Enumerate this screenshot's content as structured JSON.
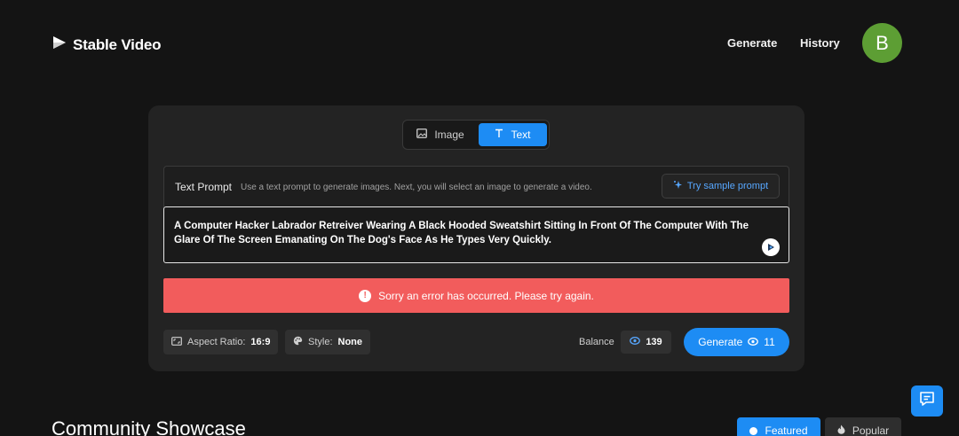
{
  "app": {
    "name": "Stable Video"
  },
  "nav": {
    "generate": "Generate",
    "history": "History",
    "avatar_initial": "B"
  },
  "mode_switch": {
    "image_label": "Image",
    "text_label": "Text",
    "active": "Text"
  },
  "prompt": {
    "label": "Text Prompt",
    "hint": "Use a text prompt to generate images. Next, you will select an image to generate a video.",
    "sample_button": "Try sample prompt",
    "value": "A Computer Hacker Labrador Retreiver Wearing A Black Hooded Sweatshirt Sitting In Front Of The Computer With The Glare Of The Screen Emanating On The Dog's Face As He Types Very Quickly."
  },
  "error": {
    "message": "Sorry an error has occurred. Please try again."
  },
  "options": {
    "aspect_label": "Aspect Ratio:",
    "aspect_value": "16:9",
    "style_label": "Style:",
    "style_value": "None"
  },
  "balance": {
    "label": "Balance",
    "value": "139"
  },
  "generate": {
    "label": "Generate",
    "cost": "11"
  },
  "showcase": {
    "title": "Community Showcase",
    "tabs": [
      "Featured",
      "Popular"
    ],
    "active_tab": "Featured"
  },
  "colors": {
    "accent": "#1d8cf4",
    "error": "#f25c5c",
    "avatar": "#5d9e34",
    "background": "#141414",
    "card": "#232323"
  },
  "icons": [
    "play-logo-icon",
    "image-icon",
    "text-icon",
    "sparkle-icon",
    "enhance-icon",
    "alert-icon",
    "aspect-ratio-icon",
    "palette-icon",
    "credits-icon",
    "chat-icon",
    "dot-icon",
    "flame-icon"
  ]
}
